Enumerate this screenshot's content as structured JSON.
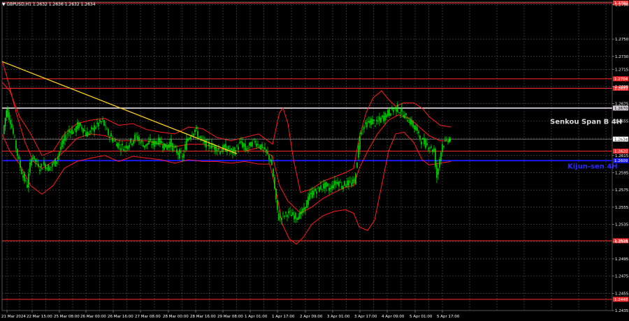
{
  "title": "▼ GBPUSD,H1  1.2632 1.2636 1.2632 1.2634",
  "chart_data": {
    "type": "candlestick",
    "symbol": "GBPUSD",
    "timeframe": "H1",
    "ohlc_current": [
      1.2632,
      1.2636,
      1.2632,
      1.2634
    ],
    "current_price": 1.2634,
    "ylim": [
      1.2435,
      1.2793
    ],
    "y_ticks": [
      "1.2790",
      "1.2750",
      "1.2730",
      "1.2715",
      "1.2695",
      "1.2675",
      "1.2655",
      "1.2635",
      "1.2615",
      "1.2595",
      "1.2575",
      "1.2555",
      "1.2535",
      "1.2515",
      "1.2495",
      "1.2475",
      "1.2455",
      "1.2435"
    ],
    "x_ticks": [
      "21 Mar 2024",
      "22 Mar 15:00",
      "25 Mar 08:00",
      "26 Mar 00:00",
      "26 Mar 16:00",
      "27 Mar 08:00",
      "28 Mar 00:00",
      "28 Mar 16:00",
      "29 Mar 08:00",
      "1 Apr 01:00",
      "1 Apr 17:00",
      "2 Apr 09:00",
      "3 Apr 01:00",
      "3 Apr 17:00",
      "4 Apr 09:00",
      "5 Apr 01:00",
      "5 Apr 17:00"
    ],
    "levels": [
      {
        "price": 1.2792,
        "label": "1.2790",
        "color": "#ff2b2b"
      },
      {
        "price": 1.2704,
        "label": "1.2704",
        "color": "#ff2b2b"
      },
      {
        "price": 1.2693,
        "label": "1.2693",
        "color": "#ff2b2b"
      },
      {
        "price": 1.267,
        "label": "1.2670",
        "color": "#d6d0d6"
      },
      {
        "price": 1.262,
        "label": "1.2620",
        "color": "#ff2b2b"
      },
      {
        "price": 1.2609,
        "label": "1.2609",
        "color": "#1a1aff"
      },
      {
        "price": 1.2516,
        "label": "1.2516",
        "color": "#ff2b2b"
      },
      {
        "price": 1.2448,
        "label": "1.2448",
        "color": "#ff2b2b"
      }
    ],
    "annotations": [
      {
        "text": "Senkou Span B 4H",
        "price": 1.2655,
        "color": "#d8d8d8"
      },
      {
        "text": "Kijun-sen 4H",
        "price": 1.2603,
        "color": "#2a2aff"
      }
    ],
    "trendline": {
      "from": [
        "21 Mar 2024",
        1.2724
      ],
      "to": [
        "29 Mar 08:00",
        1.2617
      ],
      "color": "#ffd21a"
    },
    "candle_color": "#00ff00",
    "band_color": "#ff1a1a",
    "highlight_label_bg": "#ff0000",
    "kijun_label_bg": "#1a1aff",
    "current_label_bg": "#ffffff"
  }
}
